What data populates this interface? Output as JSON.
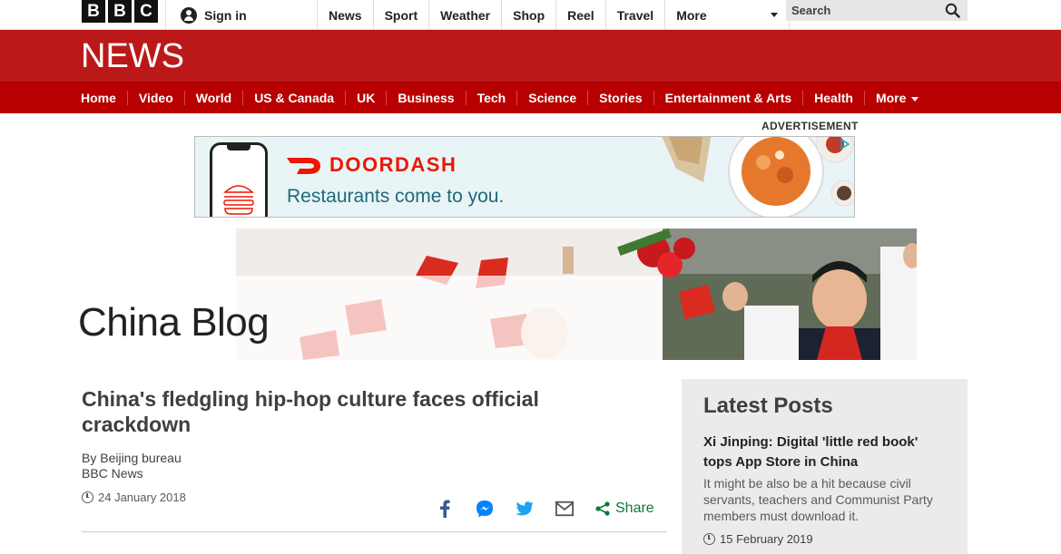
{
  "topbar": {
    "logo_letters": [
      "B",
      "B",
      "C"
    ],
    "sign_in": "Sign in",
    "nav": [
      "News",
      "Sport",
      "Weather",
      "Shop",
      "Reel",
      "Travel"
    ],
    "more": "More",
    "search_placeholder": "Search"
  },
  "news": {
    "title": "NEWS",
    "nav": [
      "Home",
      "Video",
      "World",
      "US & Canada",
      "UK",
      "Business",
      "Tech",
      "Science",
      "Stories",
      "Entertainment & Arts",
      "Health"
    ],
    "more": "More"
  },
  "ad": {
    "label": "ADVERTISEMENT",
    "brand": "DOORDASH",
    "tagline": "Restaurants come to you.",
    "brand_color": "#eb1700"
  },
  "blog": {
    "title": "China Blog"
  },
  "article": {
    "headline": "China's fledgling hip-hop culture faces official crackdown",
    "author": "By Beijing bureau",
    "outlet": "BBC News",
    "date": "24 January 2018",
    "share_label": "Share",
    "share_icons": [
      "facebook-icon",
      "messenger-icon",
      "twitter-icon",
      "email-icon",
      "share-icon"
    ]
  },
  "sidebar": {
    "heading": "Latest Posts",
    "posts": [
      {
        "title": "Xi Jinping: Digital 'little red book' tops App Store in China",
        "summary": "It might be also be a hit because civil servants, teachers and Communist Party members must download it.",
        "date": "15 February 2019"
      }
    ]
  },
  "colors": {
    "news_red": "#bb1919",
    "nav_red": "#b80000",
    "share_green": "#0c7a34"
  }
}
